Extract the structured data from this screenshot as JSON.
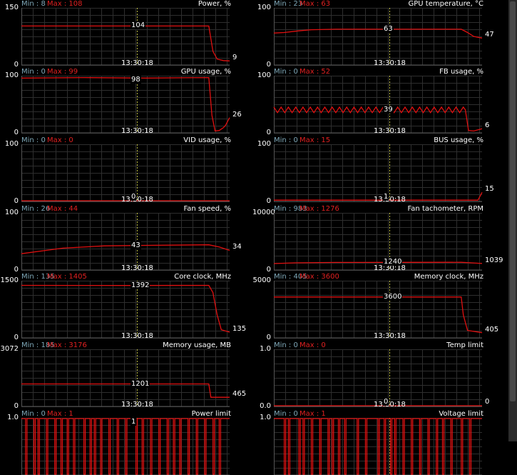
{
  "time_label": "13:30:18",
  "colors": {
    "line": "#e01010",
    "grid": "#2e2e2e",
    "cursor": "#b8b840",
    "min_text": "#7fa8b8",
    "max_text": "#e02020"
  },
  "graphs": [
    {
      "title": "Power, %",
      "min_text": "Min : 8",
      "max_text": "Max : 108",
      "ymax": "150",
      "ymin": "0",
      "current_label": "104",
      "end_label": "9",
      "chart_data": {
        "type": "line",
        "ylim": [
          0,
          150
        ],
        "points": [
          [
            0,
            103
          ],
          [
            0.75,
            103
          ],
          [
            0.9,
            103
          ],
          [
            0.92,
            35
          ],
          [
            0.94,
            14
          ],
          [
            0.97,
            10
          ],
          [
            1,
            9
          ]
        ]
      }
    },
    {
      "title": "GPU temperature, °C",
      "min_text": "Min : 23",
      "max_text": "Max : 63",
      "ymax": "100",
      "ymin": "0",
      "current_label": "63",
      "end_label": "47",
      "chart_data": {
        "type": "line",
        "ylim": [
          0,
          100
        ],
        "points": [
          [
            0,
            56
          ],
          [
            0.05,
            57
          ],
          [
            0.12,
            60
          ],
          [
            0.18,
            62
          ],
          [
            0.3,
            63
          ],
          [
            0.6,
            63
          ],
          [
            0.9,
            63
          ],
          [
            0.93,
            57
          ],
          [
            0.96,
            50
          ],
          [
            1,
            47
          ]
        ]
      }
    },
    {
      "title": "GPU usage, %",
      "min_text": "Min : 0",
      "max_text": "Max : 99",
      "ymax": "100",
      "ymin": "0",
      "current_label": "98",
      "end_label": "26",
      "chart_data": {
        "type": "line",
        "ylim": [
          0,
          100
        ],
        "points": [
          [
            0,
            97
          ],
          [
            0.3,
            98
          ],
          [
            0.6,
            97
          ],
          [
            0.9,
            98
          ],
          [
            0.915,
            30
          ],
          [
            0.93,
            2
          ],
          [
            0.95,
            3
          ],
          [
            0.97,
            8
          ],
          [
            0.98,
            12
          ],
          [
            1,
            26
          ]
        ]
      }
    },
    {
      "title": "FB usage, %",
      "min_text": "Min : 0",
      "max_text": "Max : 52",
      "ymax": "100",
      "ymin": "0",
      "current_label": "39",
      "end_label": "6",
      "chart_data": {
        "type": "line",
        "ylim": [
          0,
          100
        ],
        "wave": {
          "base": 40,
          "amp": 5,
          "period": 0.035,
          "until": 0.92
        },
        "points": [
          [
            0.92,
            40
          ],
          [
            0.935,
            3
          ],
          [
            0.96,
            2
          ],
          [
            1,
            6
          ]
        ]
      }
    },
    {
      "title": "VID usage, %",
      "min_text": "Min : 0",
      "max_text": "Max : 0",
      "ymax": "100",
      "ymin": "0",
      "current_label": "0",
      "end_label": "",
      "chart_data": {
        "type": "line",
        "ylim": [
          0,
          100
        ],
        "points": [
          [
            0,
            0
          ],
          [
            1,
            0
          ]
        ]
      }
    },
    {
      "title": "BUS usage, %",
      "min_text": "Min : 0",
      "max_text": "Max : 15",
      "ymax": "100",
      "ymin": "0",
      "current_label": "1",
      "end_label": "15",
      "chart_data": {
        "type": "line",
        "ylim": [
          0,
          100
        ],
        "points": [
          [
            0,
            1
          ],
          [
            0.98,
            1
          ],
          [
            0.99,
            8
          ],
          [
            1,
            15
          ]
        ]
      }
    },
    {
      "title": "Fan speed, %",
      "min_text": "Min : 26",
      "max_text": "Max : 44",
      "ymax": "100",
      "ymin": "0",
      "current_label": "43",
      "end_label": "34",
      "chart_data": {
        "type": "line",
        "ylim": [
          0,
          100
        ],
        "points": [
          [
            0,
            28
          ],
          [
            0.08,
            32
          ],
          [
            0.2,
            38
          ],
          [
            0.4,
            42
          ],
          [
            0.6,
            43
          ],
          [
            0.9,
            44
          ],
          [
            0.95,
            40
          ],
          [
            1,
            34
          ]
        ]
      }
    },
    {
      "title": "Fan tachometer, RPM",
      "min_text": "Min : 983",
      "max_text": "Max : 1276",
      "ymax": "10000",
      "ymin": "0",
      "current_label": "1240",
      "end_label": "1039",
      "chart_data": {
        "type": "line",
        "ylim": [
          0,
          10000
        ],
        "points": [
          [
            0,
            1030
          ],
          [
            0.1,
            1150
          ],
          [
            0.3,
            1230
          ],
          [
            0.6,
            1250
          ],
          [
            0.9,
            1260
          ],
          [
            0.95,
            1150
          ],
          [
            1,
            1039
          ]
        ]
      }
    },
    {
      "title": "Core clock, MHz",
      "min_text": "Min : 135",
      "max_text": "Max : 1405",
      "ymax": "1500",
      "ymin": "0",
      "current_label": "1392",
      "end_label": "135",
      "chart_data": {
        "type": "line",
        "ylim": [
          0,
          1500
        ],
        "points": [
          [
            0,
            1395
          ],
          [
            0.5,
            1390
          ],
          [
            0.9,
            1395
          ],
          [
            0.92,
            1200
          ],
          [
            0.94,
            600
          ],
          [
            0.96,
            200
          ],
          [
            1,
            135
          ]
        ]
      }
    },
    {
      "title": "Memory clock, MHz",
      "min_text": "Min : 405",
      "max_text": "Max : 3600",
      "ymax": "5000",
      "ymin": "0",
      "current_label": "3600",
      "end_label": "405",
      "chart_data": {
        "type": "line",
        "ylim": [
          0,
          5000
        ],
        "points": [
          [
            0,
            3600
          ],
          [
            0.9,
            3600
          ],
          [
            0.91,
            2000
          ],
          [
            0.93,
            600
          ],
          [
            1,
            405
          ]
        ]
      }
    },
    {
      "title": "Memory usage, MB",
      "min_text": "Min : 185",
      "max_text": "Max : 3176",
      "ymax": "3072",
      "ymin": "0",
      "current_label": "1201",
      "end_label": "465",
      "chart_data": {
        "type": "line",
        "ylim": [
          0,
          3072
        ],
        "points": [
          [
            0,
            1201
          ],
          [
            0.9,
            1201
          ],
          [
            0.91,
            465
          ],
          [
            1,
            465
          ]
        ]
      }
    },
    {
      "title": "Temp limit",
      "min_text": "Min : 0",
      "max_text": "Max : 0",
      "ymax": "1.0",
      "ymin": "0.0",
      "current_label": "0",
      "end_label": "0",
      "chart_data": {
        "type": "line",
        "ylim": [
          0,
          1
        ],
        "points": [
          [
            0,
            0
          ],
          [
            1,
            0
          ]
        ]
      }
    },
    {
      "title": "Power limit",
      "min_text": "Min : 0",
      "max_text": "Max : 1",
      "ymax": "1.0",
      "ymin": "",
      "current_label": "1",
      "end_label": "",
      "chart_data": {
        "type": "line",
        "ylim": [
          0,
          1
        ],
        "pulses": [
          0.02,
          0.06,
          0.08,
          0.12,
          0.16,
          0.19,
          0.22,
          0.25,
          0.3,
          0.33,
          0.35,
          0.38,
          0.42,
          0.46,
          0.5,
          0.55,
          0.58,
          0.62,
          0.66,
          0.7,
          0.73,
          0.76,
          0.8,
          0.84,
          0.88,
          0.92,
          0.95
        ]
      }
    },
    {
      "title": "Voltage limit",
      "min_text": "Min : 0",
      "max_text": "Max : 1",
      "ymax": "1.0",
      "ymin": "",
      "current_label": "",
      "end_label": "",
      "chart_data": {
        "type": "line",
        "ylim": [
          0,
          1
        ],
        "pulses": [
          0.05,
          0.07,
          0.12,
          0.14,
          0.18,
          0.22,
          0.26,
          0.28,
          0.31,
          0.34,
          0.4,
          0.44,
          0.5,
          0.53,
          0.56,
          0.58,
          0.62,
          0.66,
          0.7,
          0.74,
          0.78,
          0.81,
          0.85,
          0.9,
          0.94
        ]
      }
    }
  ]
}
